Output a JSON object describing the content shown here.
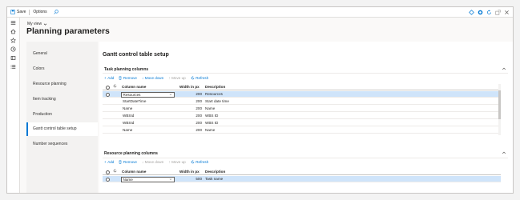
{
  "toolbar": {
    "save_label": "Save",
    "options_label": "Options"
  },
  "page": {
    "view_label": "My view",
    "title": "Planning parameters",
    "section_title": "Gantt control table setup"
  },
  "tabs": [
    {
      "label": "General"
    },
    {
      "label": "Colors"
    },
    {
      "label": "Resource planning"
    },
    {
      "label": "Item tracking"
    },
    {
      "label": "Production"
    },
    {
      "label": "Gantt control table setup"
    },
    {
      "label": "Number sequences"
    }
  ],
  "task_panel": {
    "title": "Task planning columns",
    "actions": {
      "add": "Add",
      "remove": "Remove",
      "move_down": "Move down",
      "move_up": "Move up",
      "refresh": "Refresh"
    },
    "columns": {
      "name": "Column name",
      "width": "Width in px",
      "desc": "Description"
    },
    "rows": [
      {
        "name": "Resources",
        "width": "200",
        "desc": "Resources"
      },
      {
        "name": "StartDateTime",
        "width": "200",
        "desc": "Start date time"
      },
      {
        "name": "Name",
        "width": "200",
        "desc": "Name"
      },
      {
        "name": "WBSId",
        "width": "200",
        "desc": "WBS ID"
      },
      {
        "name": "WBSId",
        "width": "200",
        "desc": "WBS ID"
      },
      {
        "name": "Name",
        "width": "200",
        "desc": "Name"
      }
    ]
  },
  "resource_panel": {
    "title": "Resource planning columns",
    "actions": {
      "add": "Add",
      "remove": "Remove",
      "move_down": "Move down",
      "move_up": "Move up",
      "refresh": "Refresh"
    },
    "columns": {
      "name": "Column name",
      "width": "Width in px",
      "desc": "Description"
    },
    "rows": [
      {
        "name": "Name",
        "width": "500",
        "desc": "Task name"
      }
    ]
  },
  "colors": {
    "accent": "#0078d4",
    "selected_row": "#cfe4fa"
  }
}
